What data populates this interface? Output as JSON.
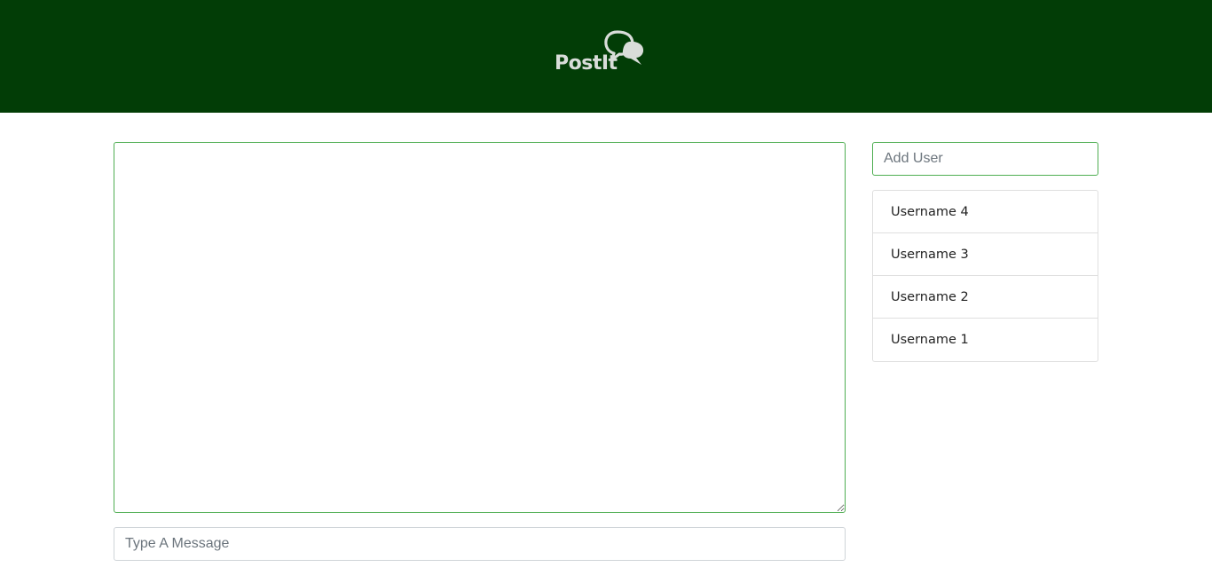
{
  "header": {
    "logo_text": "PostIt",
    "background_color": "#023d06",
    "logo_icon": "speech-bubbles-icon"
  },
  "chat": {
    "messages_value": "",
    "border_color": "#4fae52"
  },
  "composer": {
    "placeholder": "Type A Message",
    "value": ""
  },
  "users": {
    "add_placeholder": "Add User",
    "items": [
      {
        "label": "Username 4"
      },
      {
        "label": "Username 3"
      },
      {
        "label": "Username 2"
      },
      {
        "label": "Username 1"
      }
    ]
  }
}
